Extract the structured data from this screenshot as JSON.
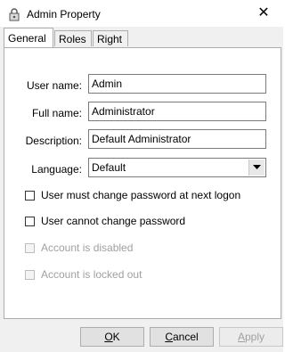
{
  "window": {
    "title": "Admin Property",
    "close_glyph": "✕"
  },
  "tabs": [
    {
      "label": "General",
      "active": true
    },
    {
      "label": "Roles",
      "active": false
    },
    {
      "label": "Right",
      "active": false
    }
  ],
  "form": {
    "user_name": {
      "label": "User name:",
      "value": "Admin"
    },
    "full_name": {
      "label": "Full name:",
      "value": "Administrator"
    },
    "description": {
      "label": "Description:",
      "value": "Default Administrator"
    },
    "language": {
      "label": "Language:",
      "value": "Default"
    }
  },
  "checkboxes": [
    {
      "label": "User must change password at next logon",
      "checked": false,
      "enabled": true
    },
    {
      "label": "User cannot change password",
      "checked": false,
      "enabled": true
    },
    {
      "label": "Account is disabled",
      "checked": false,
      "enabled": false
    },
    {
      "label": "Account is locked out",
      "checked": false,
      "enabled": false
    }
  ],
  "buttons": {
    "ok": {
      "mnemonic": "O",
      "rest": "K"
    },
    "cancel": {
      "mnemonic": "C",
      "rest": "ancel"
    },
    "apply": {
      "mnemonic": "A",
      "rest": "pply"
    }
  }
}
